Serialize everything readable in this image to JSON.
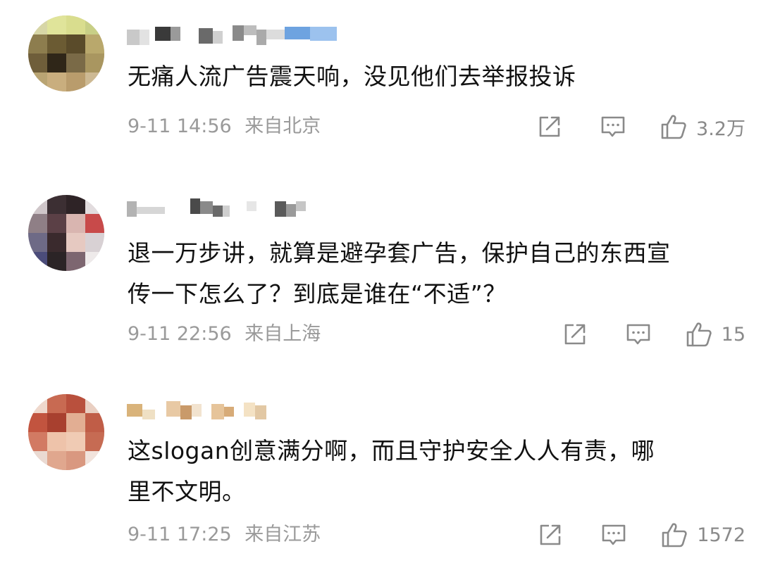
{
  "comments": [
    {
      "text": "无痛人流广告震天响，没见他们去举报投诉",
      "date": "9-11 14:56",
      "location": "来自北京",
      "likes": "3.2万",
      "icons": [
        "share-icon",
        "comment-icon",
        "thumbs-up-icon"
      ]
    },
    {
      "text": "退一万步讲，就算是避孕套广告，保护自己的东西宣\n传一下怎么了？到底是谁在“不适”？",
      "date": "9-11 22:56",
      "location": "来自上海",
      "likes": "15",
      "icons": [
        "share-icon",
        "comment-icon",
        "thumbs-up-icon"
      ]
    },
    {
      "text": "这slogan创意满分啊，而且守护安全人人有责，哪\n里不文明。",
      "date": "9-11 17:25",
      "location": "来自江苏",
      "likes": "1572",
      "icons": [
        "share-icon",
        "comment-icon",
        "thumbs-up-icon"
      ]
    }
  ],
  "colors": {
    "text": "#111111",
    "meta": "#9a9a9a",
    "icon": "#8a8a8a",
    "background": "#ffffff"
  }
}
